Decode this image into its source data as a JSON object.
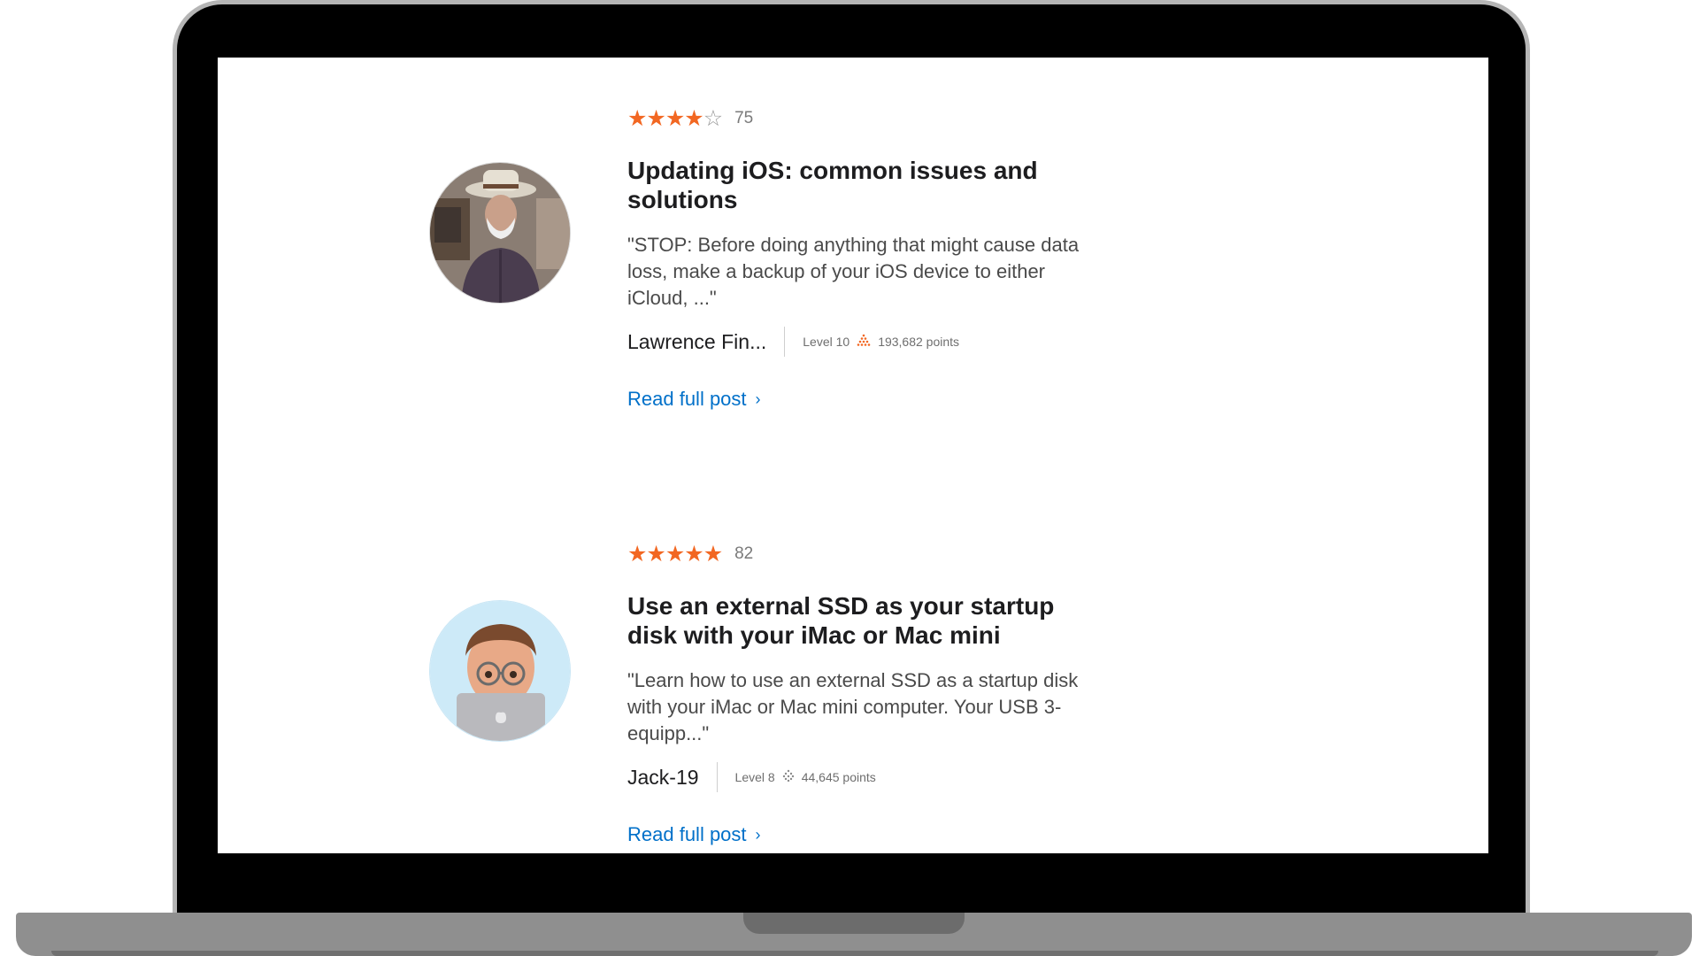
{
  "posts": [
    {
      "rating_stars": 4,
      "rating_count": "75",
      "title": "Updating iOS: common issues and solutions",
      "excerpt": "\"STOP: Before doing anything that might cause data loss, make a backup of your iOS device to either iCloud, ...\"",
      "author": "Lawrence Fin...",
      "level": "Level 10",
      "level_icon": "level-10-pyramid-icon",
      "points": "193,682 points",
      "link": "Read full post"
    },
    {
      "rating_stars": 5,
      "rating_count": "82",
      "title": "Use an external SSD as your startup disk with your iMac or Mac mini",
      "excerpt": "\"Learn how to use an external SSD as a startup disk with your iMac or Mac mini computer. Your USB 3-equipp...\"",
      "author": "Jack-19",
      "level": "Level 8",
      "level_icon": "level-8-dots-icon",
      "points": "44,645 points",
      "link": "Read full post"
    }
  ],
  "colors": {
    "star": "#f26722",
    "link": "#0070c9",
    "title": "#1d1d1f"
  }
}
